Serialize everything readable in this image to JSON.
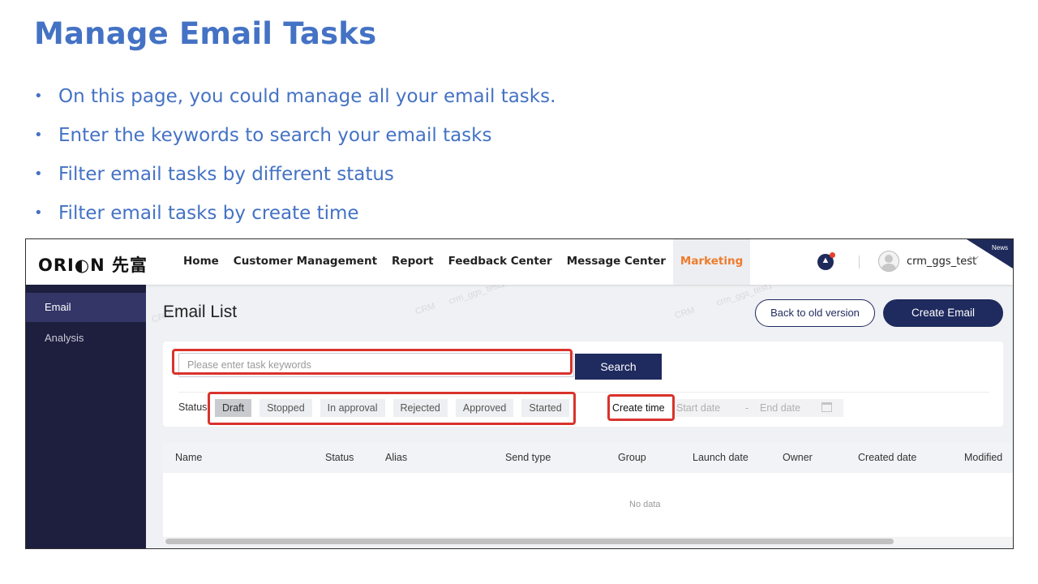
{
  "slide": {
    "title": "Manage Email Tasks",
    "bullets": [
      "On this page, you could manage all your email tasks.",
      "Enter the keywords to search your email tasks",
      "Filter email tasks by different status",
      "Filter email tasks by create time"
    ],
    "colors": {
      "title": "#4472c4",
      "highlight": "#d9332c"
    }
  },
  "app": {
    "logo": "ORI◐N 先富",
    "nav": [
      "Home",
      "Customer Management",
      "Report",
      "Feedback Center",
      "Message Center",
      "Marketing"
    ],
    "active_nav": "Marketing",
    "notification_icon": "bell-icon",
    "username": "crm_ggs_test",
    "news_label": "News",
    "colors": {
      "primary": "#1f2a5e",
      "active_nav": "#f07b2a",
      "sidebar": "#1e1e3f"
    },
    "sidebar": {
      "items": [
        "Email",
        "Analysis"
      ],
      "active": "Email"
    },
    "page_title": "Email List",
    "buttons": {
      "back": "Back to old version",
      "create": "Create Email"
    },
    "search": {
      "placeholder": "Please enter task keywords",
      "value": "",
      "button": "Search"
    },
    "filters": {
      "status_label": "Status",
      "statuses": [
        "Draft",
        "Stopped",
        "In approval",
        "Rejected",
        "Approved",
        "Started"
      ],
      "active_status": "Draft",
      "create_time_label": "Create time",
      "start_placeholder": "Start date",
      "separator": "-",
      "end_placeholder": "End date"
    },
    "table": {
      "columns": [
        "Name",
        "Status",
        "Alias",
        "Send type",
        "Group",
        "Launch date",
        "Owner",
        "Created date",
        "Modified"
      ],
      "empty_text": "No data"
    },
    "watermark": [
      "CRM",
      "crm_ggs_test1"
    ]
  }
}
